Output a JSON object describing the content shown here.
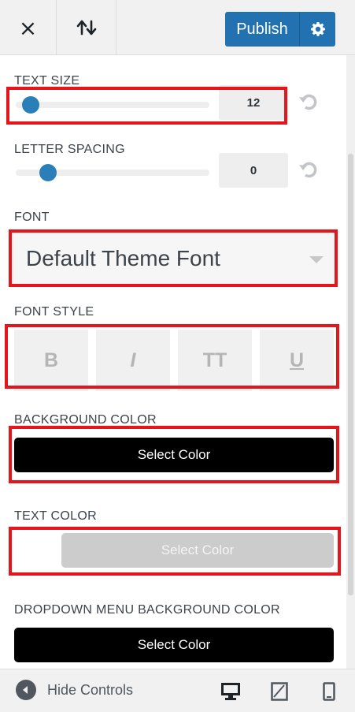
{
  "header": {
    "close_icon": "×",
    "sort_icon": "sort-icon",
    "publish_label": "Publish",
    "settings_icon": "gear-icon"
  },
  "text_size": {
    "label": "TEXT SIZE",
    "value": "12",
    "slider_fraction": 0.04
  },
  "letter_spacing": {
    "label": "LETTER SPACING",
    "value": "0",
    "slider_fraction": 0.14
  },
  "font": {
    "label": "FONT",
    "selected": "Default Theme Font"
  },
  "font_style": {
    "label": "FONT STYLE",
    "buttons": [
      {
        "label": "B",
        "name": "bold"
      },
      {
        "label": "I",
        "name": "italic"
      },
      {
        "label": "TT",
        "name": "uppercase"
      },
      {
        "label": "U",
        "name": "underline"
      }
    ]
  },
  "background_color": {
    "label": "BACKGROUND COLOR",
    "button": "Select Color",
    "color": "#000000"
  },
  "text_color": {
    "label": "TEXT COLOR",
    "button": "Select Color",
    "color": "#cccccc"
  },
  "dropdown_bg_color": {
    "label": "DROPDOWN MENU BACKGROUND COLOR",
    "button": "Select Color",
    "color": "#000000"
  },
  "footer": {
    "hide_label": "Hide Controls",
    "devices": [
      "desktop-icon",
      "tablet-icon",
      "mobile-icon"
    ]
  },
  "colors": {
    "accent": "#2271b1",
    "highlight": "#e4161b"
  }
}
